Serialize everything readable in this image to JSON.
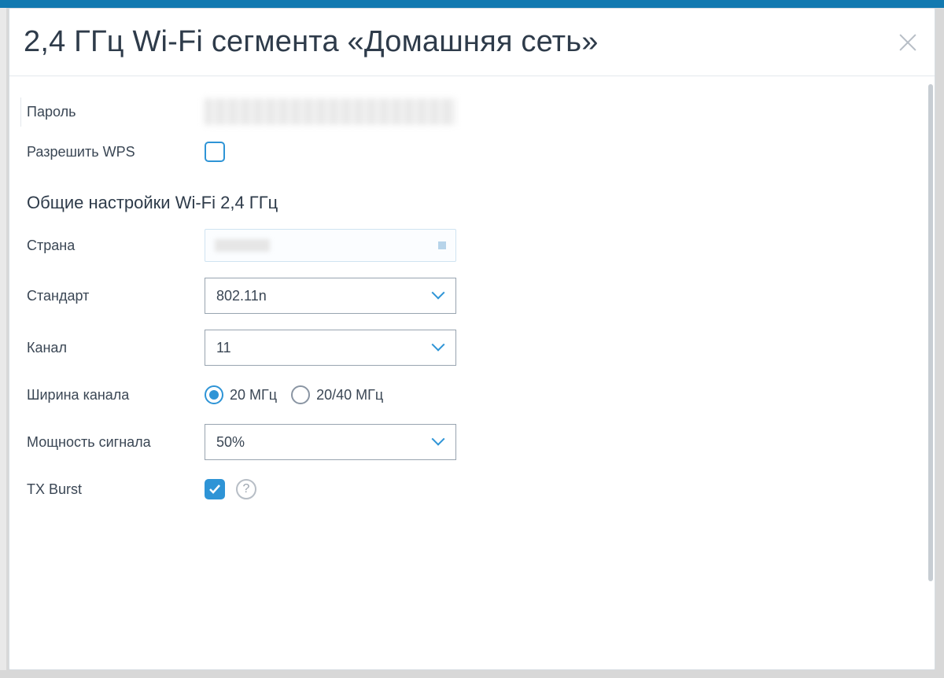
{
  "header": {
    "title": "2,4 ГГц Wi-Fi сегмента «Домашняя сеть»"
  },
  "fields": {
    "password_label": "Пароль",
    "allow_wps_label": "Разрешить WPS",
    "allow_wps_checked": false,
    "section_title": "Общие настройки Wi-Fi 2,4 ГГц",
    "country_label": "Страна",
    "standard_label": "Стандарт",
    "standard_value": "802.11n",
    "channel_label": "Канал",
    "channel_value": "11",
    "width_label": "Ширина канала",
    "width_options": {
      "opt1": "20 МГц",
      "opt2": "20/40 МГц"
    },
    "width_selected": "opt1",
    "power_label": "Мощность сигнала",
    "power_value": "50%",
    "txburst_label": "TX Burst",
    "txburst_checked": true
  }
}
